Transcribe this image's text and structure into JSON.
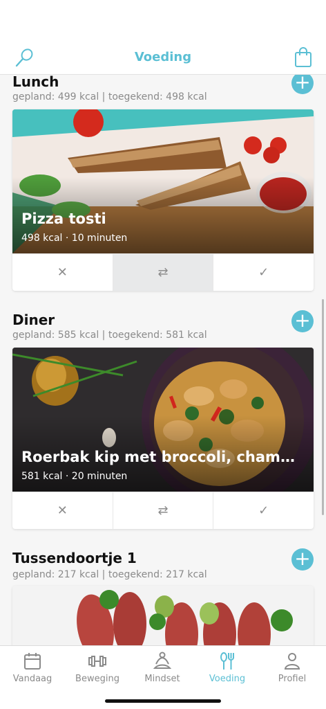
{
  "header": {
    "title": "Voeding",
    "left_icon": "whisk-icon",
    "right_icon": "shopping-bag-icon"
  },
  "accent": "#5bbfd4",
  "sections": [
    {
      "title": "Lunch",
      "subtitle": "gepland: 499 kcal | toegekend: 498 kcal",
      "meal": {
        "name": "Pizza tosti",
        "meta": "498 kcal · 10 minuten"
      },
      "actions": [
        {
          "icon": "close-icon",
          "glyph": "✕"
        },
        {
          "icon": "swap-icon",
          "glyph": "⇄",
          "active": true
        },
        {
          "icon": "checkmark-icon",
          "glyph": "✓"
        }
      ]
    },
    {
      "title": "Diner",
      "subtitle": "gepland: 585 kcal | toegekend: 581 kcal",
      "meal": {
        "name": "Roerbak kip met broccoli, champi...",
        "meta": "581 kcal · 20 minuten"
      },
      "actions": [
        {
          "icon": "close-icon",
          "glyph": "✕"
        },
        {
          "icon": "swap-icon",
          "glyph": "⇄"
        },
        {
          "icon": "checkmark-icon",
          "glyph": "✓"
        }
      ]
    },
    {
      "title": "Tussendoortje 1",
      "subtitle": "gepland: 217 kcal | toegekend: 217 kcal"
    }
  ],
  "add_glyph": "+",
  "tabs": [
    {
      "label": "Vandaag",
      "icon": "calendar-icon"
    },
    {
      "label": "Beweging",
      "icon": "dumbbell-icon"
    },
    {
      "label": "Mindset",
      "icon": "meditation-icon"
    },
    {
      "label": "Voeding",
      "icon": "fork-knife-icon",
      "active": true
    },
    {
      "label": "Profiel",
      "icon": "person-icon"
    }
  ]
}
